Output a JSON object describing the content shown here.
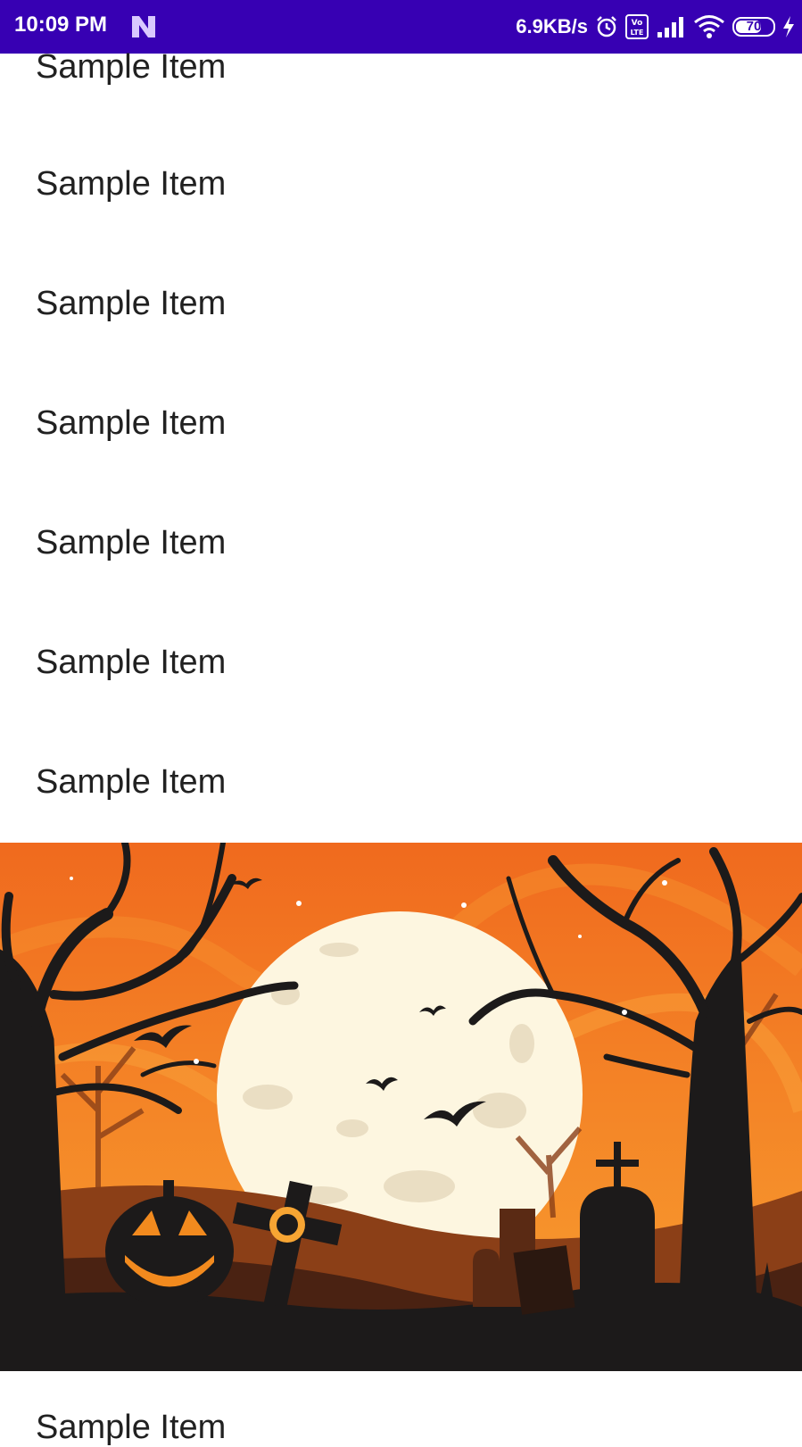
{
  "status_bar": {
    "time": "10:09 PM",
    "network_speed": "6.9KB/s",
    "battery_level": "70",
    "icons": [
      "n-app-icon",
      "alarm-icon",
      "volte-icon",
      "signal-icon",
      "wifi-icon",
      "battery-icon",
      "charging-icon"
    ],
    "background": "#3700b3"
  },
  "list": {
    "items": [
      {
        "label": "Sample Item"
      },
      {
        "label": "Sample Item"
      },
      {
        "label": "Sample Item"
      },
      {
        "label": "Sample Item"
      },
      {
        "label": "Sample Item"
      },
      {
        "label": "Sample Item"
      },
      {
        "label": "Sample Item"
      }
    ],
    "after_banner": {
      "label": "Sample Item"
    }
  },
  "banner": {
    "theme": "halloween-graveyard",
    "colors": {
      "sky": "#f07a22",
      "moon": "#fdf6e0",
      "silhouette": "#1c1a1a",
      "pumpkin": "#f28a1e"
    }
  }
}
